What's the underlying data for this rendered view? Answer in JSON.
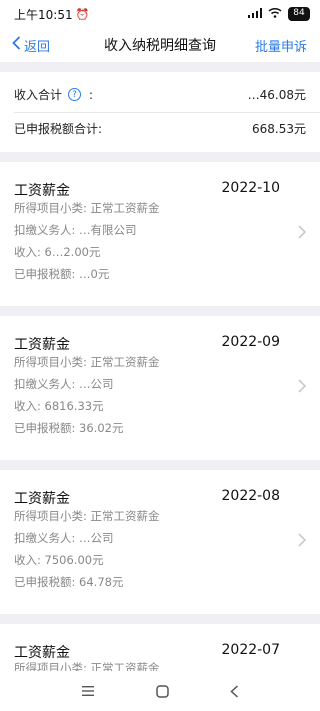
{
  "status_bar": {
    "time": "上午10:51",
    "battery": "84"
  },
  "nav": {
    "back_label": "返回",
    "title": "收入纳税明细查询",
    "appeal_label": "批量申诉"
  },
  "summary": {
    "income_label": "收入合计",
    "income_colon": ":",
    "income_value": "…46.08元",
    "tax_label": "已申报税额合计:",
    "tax_value": "668.53元"
  },
  "records": [
    {
      "type": "工资薪金",
      "period": "2022-10",
      "subtype_label": "所得项目小类:",
      "subtype": "正常工资薪金",
      "withholder_label": "扣缴义务人:",
      "withholder": "…有限公司",
      "income_label": "收入:",
      "income": "6…2.00元",
      "tax_label": "已申报税额:",
      "tax": "…0元"
    },
    {
      "type": "工资薪金",
      "period": "2022-09",
      "subtype_label": "所得项目小类:",
      "subtype": "正常工资薪金",
      "withholder_label": "扣缴义务人:",
      "withholder": "…公司",
      "income_label": "收入:",
      "income": "6816.33元",
      "tax_label": "已申报税额:",
      "tax": "36.02元"
    },
    {
      "type": "工资薪金",
      "period": "2022-08",
      "subtype_label": "所得项目小类:",
      "subtype": "正常工资薪金",
      "withholder_label": "扣缴义务人:",
      "withholder": "…公司",
      "income_label": "收入:",
      "income": "7506.00元",
      "tax_label": "已申报税额:",
      "tax": "64.78元"
    },
    {
      "type": "工资薪金",
      "period": "2022-07",
      "subtype_label": "所得项目小类:",
      "subtype": "正常工资薪金"
    }
  ],
  "colors": {
    "accent": "#2d7be6",
    "background": "#efeff4",
    "secondary_text": "#888888"
  },
  "icons": {
    "back": "chevron-left-icon",
    "help": "question-circle-icon",
    "row_arrow": "chevron-right-icon",
    "menu": "menu-icon",
    "home": "home-icon",
    "back_nav": "back-icon"
  }
}
